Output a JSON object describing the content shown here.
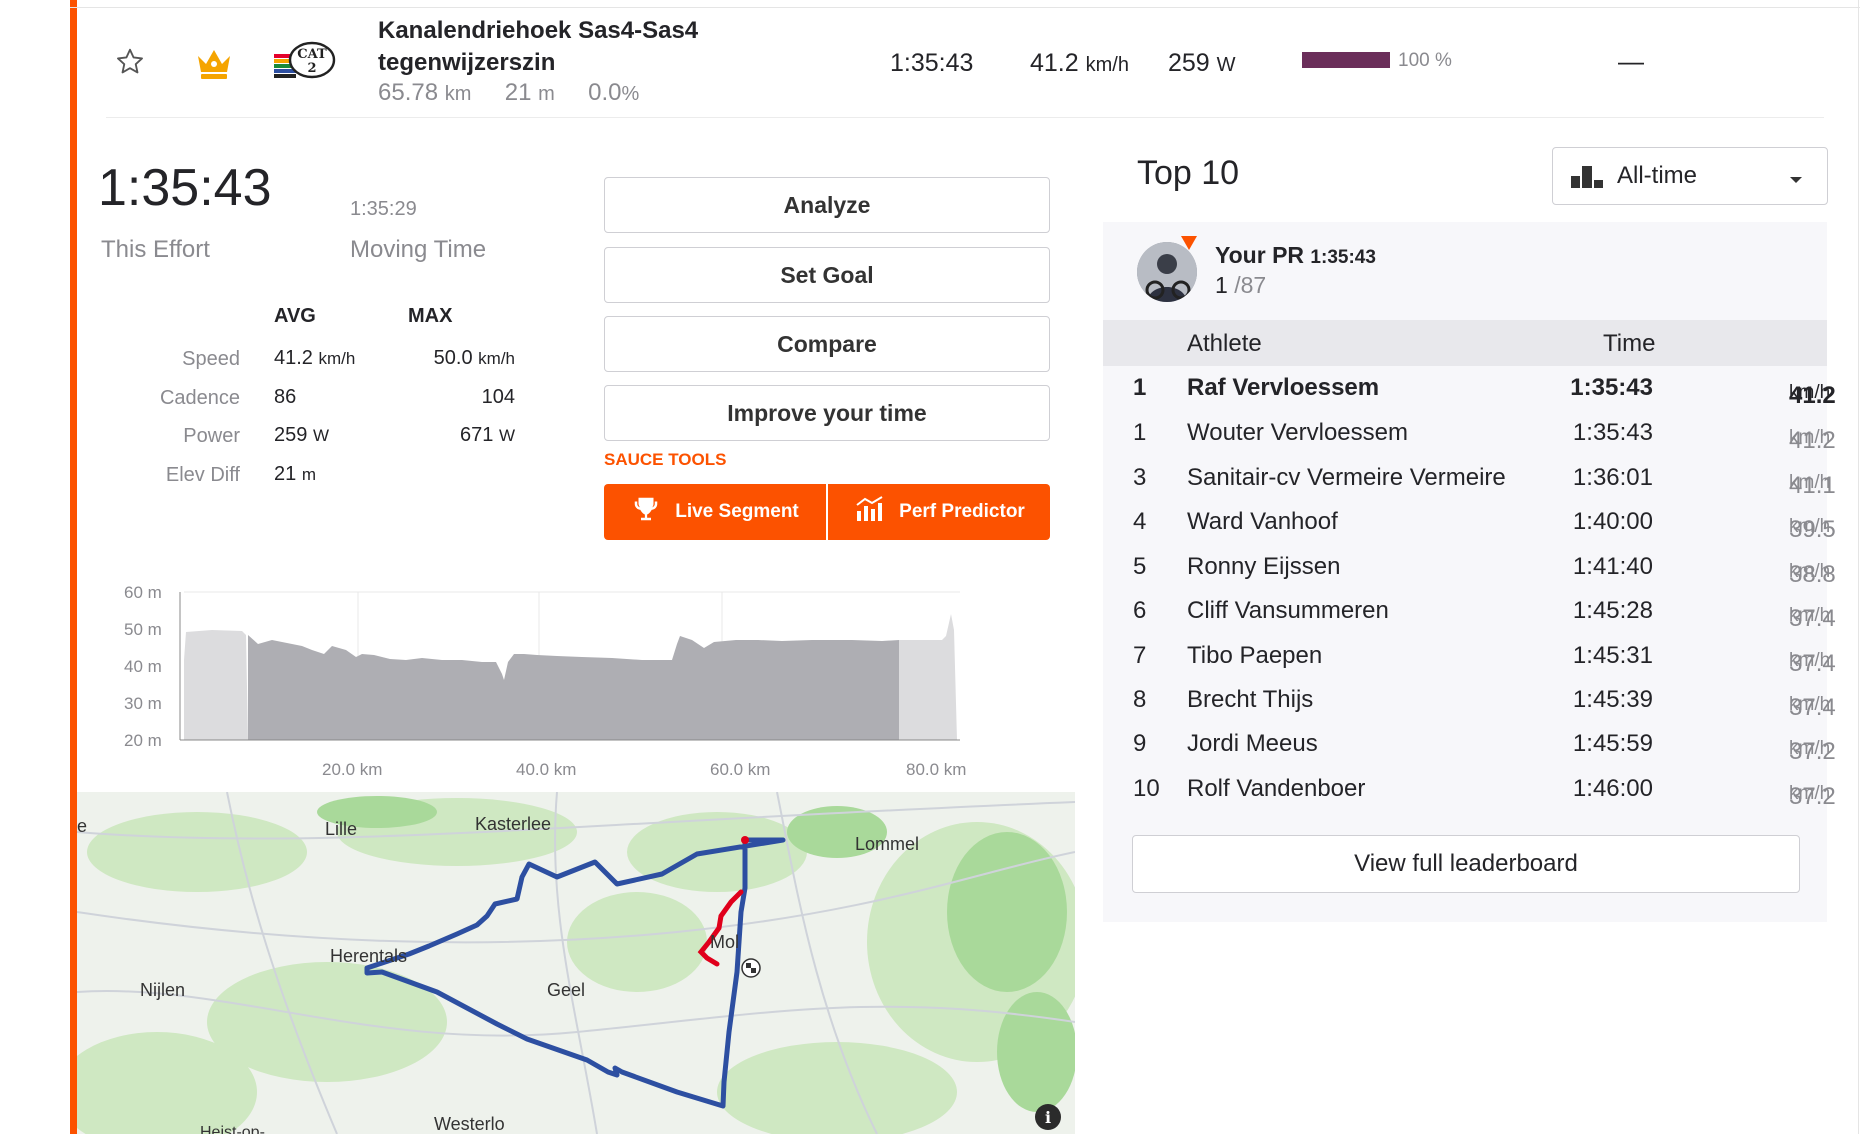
{
  "segment": {
    "name_line1": "Kanalendriehoek Sas4-Sas4",
    "name_line2": "tegenwijzerszin",
    "distance": "65.78",
    "distance_unit": "km",
    "elev": "21",
    "elev_unit": "m",
    "grade": "0.0",
    "grade_unit": "%",
    "time": "1:35:43",
    "speed": "41.2",
    "speed_unit": "km/h",
    "power": "259",
    "power_unit": "W",
    "pct": "100 %",
    "pct_value": 100,
    "dash": "—",
    "cat_badge": "CAT 2"
  },
  "effort": {
    "time": "1:35:43",
    "time_label": "This Effort",
    "moving_time": "1:35:29",
    "moving_label": "Moving Time",
    "col_avg": "AVG",
    "col_max": "MAX",
    "rows": [
      {
        "label": "Speed",
        "avg": "41.2",
        "avg_unit": "km/h",
        "max": "50.0",
        "max_unit": "km/h"
      },
      {
        "label": "Cadence",
        "avg": "86",
        "avg_unit": "",
        "max": "104",
        "max_unit": ""
      },
      {
        "label": "Power",
        "avg": "259",
        "avg_unit": "W",
        "max": "671",
        "max_unit": "W"
      },
      {
        "label": "Elev Diff",
        "avg": "21",
        "avg_unit": "m",
        "max": "",
        "max_unit": ""
      }
    ]
  },
  "actions": {
    "analyze": "Analyze",
    "set_goal": "Set Goal",
    "compare": "Compare",
    "improve": "Improve your time",
    "sauce_label": "SAUCE TOOLS",
    "live_segment": "Live Segment",
    "perf_predictor": "Perf Predictor"
  },
  "elevation_chart": {
    "y_ticks": [
      "60 m",
      "50 m",
      "40 m",
      "30 m",
      "20 m"
    ],
    "x_ticks": [
      "20.0 km",
      "40.0 km",
      "60.0 km",
      "80.0 km"
    ]
  },
  "map": {
    "places": [
      "Lille",
      "Kasterlee",
      "Lommel",
      "Herentals",
      "Nijlen",
      "Geel",
      "Mol",
      "Westerlo",
      "Heist-op-"
    ],
    "place_labels": {
      "lille": "Lille",
      "kasterlee": "Kasterlee",
      "lommel": "Lommel",
      "herentals": "Herentals",
      "nijlen": "Nijlen",
      "geel": "Geel",
      "mol": "Mol",
      "westerlo": "Westerlo",
      "heist": "Heist-op-",
      "e": "e"
    },
    "info": "i"
  },
  "leaderboard": {
    "title": "Top 10",
    "filter": "All-time",
    "pr_label": "Your PR",
    "pr_time": "1:35:43",
    "pr_rank": "1",
    "pr_total": "/87",
    "col_athlete": "Athlete",
    "col_time": "Time",
    "rows": [
      {
        "rank": "1",
        "name": "Raf Vervloessem",
        "time": "1:35:43",
        "speed": "41.2",
        "unit": "km/h",
        "bold": true
      },
      {
        "rank": "1",
        "name": "Wouter Vervloessem",
        "time": "1:35:43",
        "speed": "41.2",
        "unit": "km/h"
      },
      {
        "rank": "3",
        "name": "Sanitair-cv Vermeire Vermeire",
        "time": "1:36:01",
        "speed": "41.1",
        "unit": "km/h"
      },
      {
        "rank": "4",
        "name": "Ward Vanhoof",
        "time": "1:40:00",
        "speed": "39.5",
        "unit": "km/h"
      },
      {
        "rank": "5",
        "name": "Ronny Eijssen",
        "time": "1:41:40",
        "speed": "38.8",
        "unit": "km/h"
      },
      {
        "rank": "6",
        "name": "Cliff Vansummeren",
        "time": "1:45:28",
        "speed": "37.4",
        "unit": "km/h"
      },
      {
        "rank": "7",
        "name": "Tibo Paepen",
        "time": "1:45:31",
        "speed": "37.4",
        "unit": "km/h"
      },
      {
        "rank": "8",
        "name": "Brecht Thijs",
        "time": "1:45:39",
        "speed": "37.4",
        "unit": "km/h"
      },
      {
        "rank": "9",
        "name": "Jordi Meeus",
        "time": "1:45:59",
        "speed": "37.2",
        "unit": "km/h"
      },
      {
        "rank": "10",
        "name": "Rolf Vandenboer",
        "time": "1:46:00",
        "speed": "37.2",
        "unit": "km/h"
      }
    ],
    "view_full": "View full leaderboard"
  },
  "colors": {
    "accent": "#fc5200",
    "crown": "#f5a400",
    "progress": "#6b2e5a",
    "route": "#2d4fa1",
    "route_highlight": "#e0001b"
  }
}
